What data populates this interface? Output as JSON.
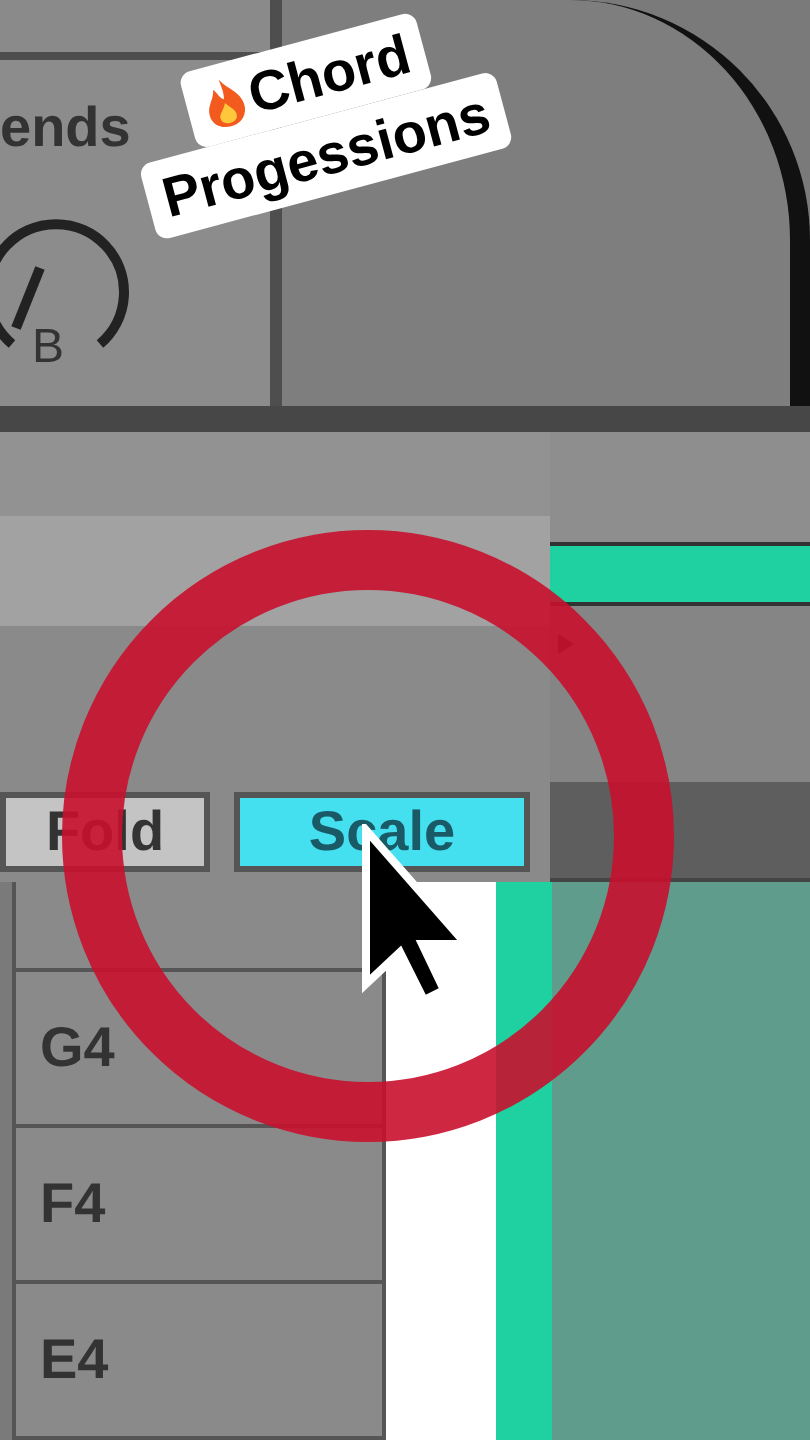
{
  "sends_panel": {
    "label": "ends",
    "knob_label": "B"
  },
  "toolbar": {
    "buttons": [
      {
        "label": "Fold",
        "selected": false
      },
      {
        "label": "Scale",
        "selected": true
      }
    ]
  },
  "piano_rows": [
    {
      "note": "G4"
    },
    {
      "note": "F4"
    },
    {
      "note": "E4"
    }
  ],
  "caption": {
    "lines": [
      "Chord",
      "Progessions"
    ]
  }
}
